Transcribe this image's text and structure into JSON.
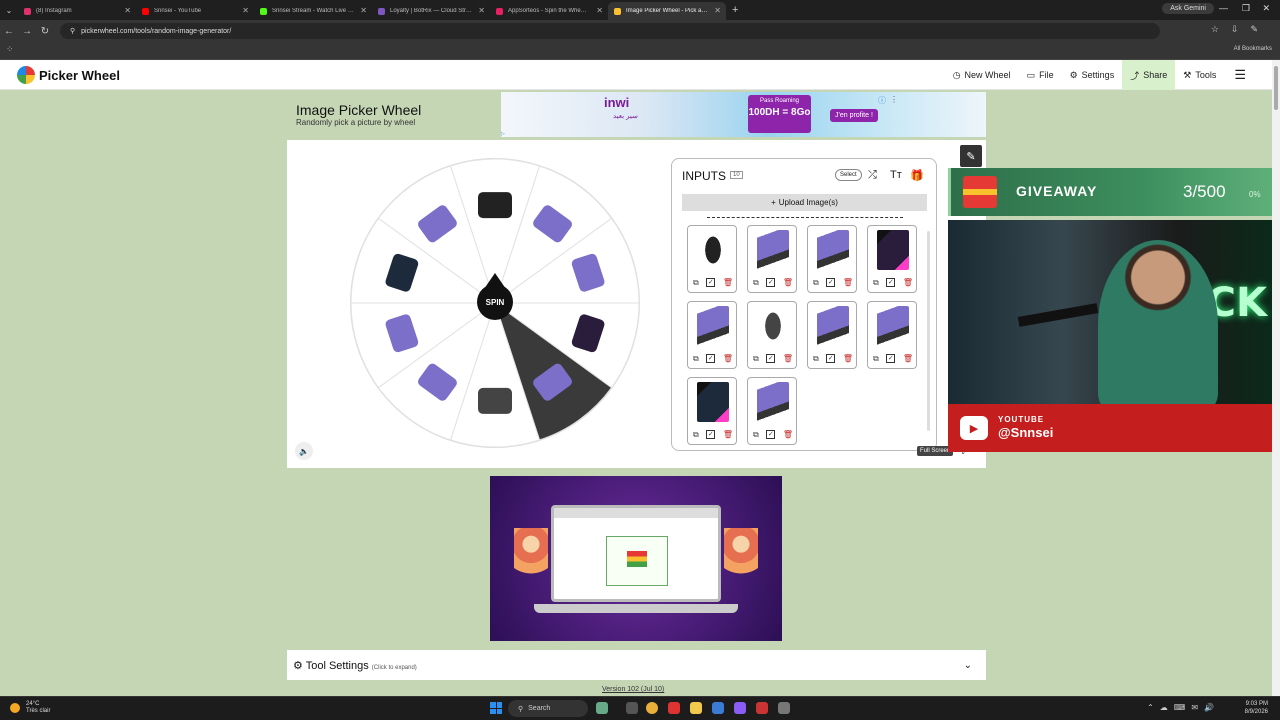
{
  "browser": {
    "tabs": [
      {
        "title": "(8) Instagram",
        "color": "#e1306c",
        "active": false
      },
      {
        "title": "Snnsei - YouTube",
        "color": "#ff0000",
        "active": false
      },
      {
        "title": "Snnsei Stream - Watch Live on Kick",
        "color": "#53fc18",
        "active": false
      },
      {
        "title": "Loyalty | BotRix — Cloud Stream",
        "color": "#7e57c2",
        "active": false
      },
      {
        "title": "AppSorteos - Spin the Wheel Online",
        "color": "#e91e63",
        "active": false
      },
      {
        "title": "Image Picker Wheel - Pick a Random",
        "color": "#fbc02d",
        "active": true
      }
    ],
    "new_tab": "+",
    "ask_gemini": "Ask Gemini",
    "url": "pickerwheel.com/tools/random-image-generator/",
    "all_bookmarks": "All Bookmarks"
  },
  "site": {
    "logo": "Picker Wheel",
    "nav": [
      {
        "label": "New Wheel",
        "icon": "◷"
      },
      {
        "label": "File",
        "icon": "▭"
      },
      {
        "label": "Settings",
        "icon": "⚙"
      },
      {
        "label": "Share",
        "icon": "⤴"
      },
      {
        "label": "Tools",
        "icon": "⚒"
      }
    ],
    "menu_icon": "☰"
  },
  "tool": {
    "title": "Image Picker Wheel",
    "subtitle": "Randomly pick a picture by wheel",
    "spin_label": "SPIN",
    "full_screen": "Full Screen",
    "settings_label": "Tool Settings",
    "settings_hint": "(Click to expand)",
    "version": "Version 102 (Jul 10)"
  },
  "ad": {
    "brand": "inwi",
    "brand_sub": "سير بعيد",
    "offer_title": "Pass Roaming",
    "offer_value": "100DH = 8Go",
    "cta": "J'en profite !"
  },
  "inputs": {
    "title": "INPUTS",
    "count": "10",
    "select_label": "Select",
    "upload_label": "Upload Image(s)",
    "items": [
      {
        "kind": "mouse",
        "color": "#222"
      },
      {
        "kind": "bundle",
        "color": "#7b6fc9"
      },
      {
        "kind": "bundle",
        "color": "#7b6fc9"
      },
      {
        "kind": "pc",
        "color": "#2a1c3b"
      },
      {
        "kind": "bundle",
        "color": "#7b6fc9"
      },
      {
        "kind": "mouse-pro",
        "color": "#444"
      },
      {
        "kind": "bundle",
        "color": "#7b6fc9"
      },
      {
        "kind": "bundle",
        "color": "#7b6fc9"
      },
      {
        "kind": "pc",
        "color": "#1c2a3b"
      },
      {
        "kind": "bundle",
        "color": "#7b6fc9"
      }
    ]
  },
  "wheel": {
    "segments": 10,
    "highlight_index": 4,
    "segment_colors": [
      "#222",
      "#7b6fc9",
      "#7b6fc9",
      "#2a1c3b",
      "#7b6fc9",
      "#444",
      "#7b6fc9",
      "#7b6fc9",
      "#1c2a3b",
      "#7b6fc9"
    ]
  },
  "overlay": {
    "giveaway_label": "GIVEAWAY",
    "giveaway_count": "3/500",
    "giveaway_pct": "0%",
    "neon_text": "KICK",
    "yt_label": "YOUTUBE",
    "yt_handle": "@Snnsei"
  },
  "taskbar": {
    "temp": "24°C",
    "weather": "Très clair",
    "search": "Search",
    "time": "9:03 PM",
    "date": "8/9/2026"
  }
}
